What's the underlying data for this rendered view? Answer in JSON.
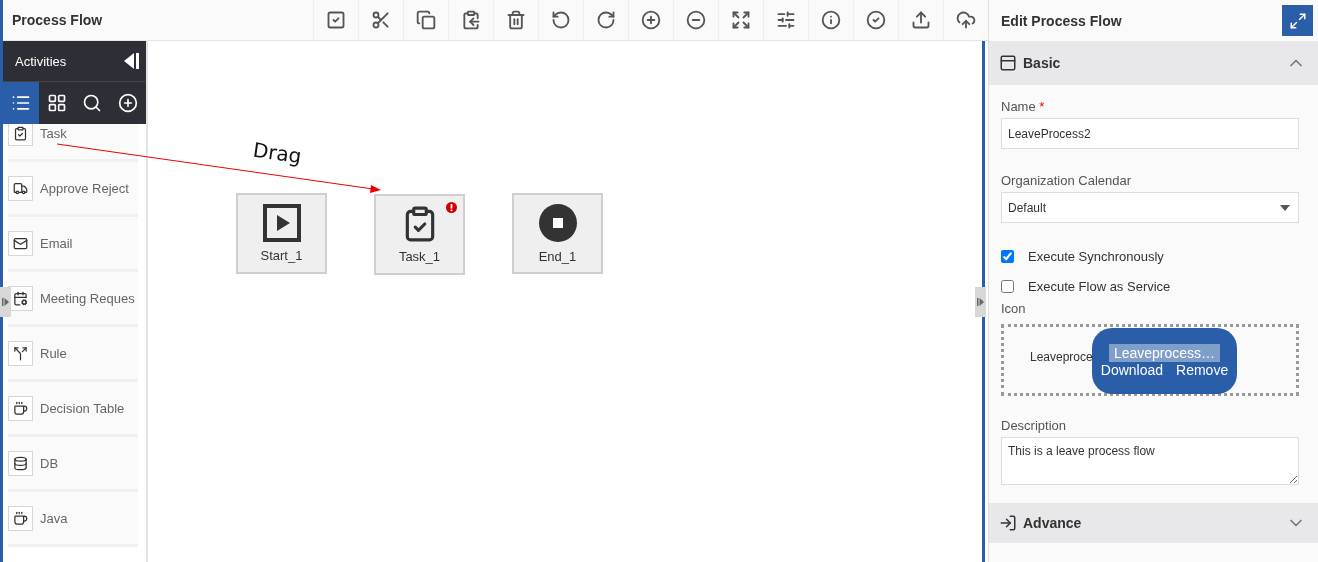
{
  "header": {
    "title": "Process Flow"
  },
  "palette": {
    "title": "Activities",
    "tabs": [
      {
        "kind": "list",
        "selected": true
      },
      {
        "kind": "grid",
        "selected": false
      },
      {
        "kind": "search",
        "selected": false
      },
      {
        "kind": "add",
        "selected": false
      }
    ],
    "items": [
      {
        "kind": "task",
        "label": "Task"
      },
      {
        "kind": "approve",
        "label": "Approve Reject"
      },
      {
        "kind": "email",
        "label": "Email"
      },
      {
        "kind": "meeting",
        "label": "Meeting Reques"
      },
      {
        "kind": "rule",
        "label": "Rule"
      },
      {
        "kind": "decision",
        "label": "Decision Table"
      },
      {
        "kind": "db",
        "label": "DB"
      },
      {
        "kind": "java",
        "label": "Java"
      }
    ]
  },
  "canvas": {
    "annotation": "Drag",
    "nodes": [
      {
        "kind": "start",
        "label": "Start_1",
        "error": false
      },
      {
        "kind": "task",
        "label": "Task_1",
        "error": true
      },
      {
        "kind": "end",
        "label": "End_1",
        "error": false
      }
    ]
  },
  "panel": {
    "title": "Edit Process Flow",
    "basic": {
      "title": "Basic",
      "expanded": true
    },
    "name": {
      "label": "Name",
      "required_mark": "*",
      "value": "LeaveProcess2"
    },
    "calendar": {
      "label": "Organization Calendar",
      "value": "Default"
    },
    "options": [
      {
        "label": "Execute Synchronously",
        "checked": true
      },
      {
        "label": "Execute Flow as Service",
        "checked": false
      }
    ],
    "icon": {
      "label": "Icon",
      "file": "Leaveproce",
      "preview": "Leaveprocess…",
      "actions": [
        "Download",
        "Remove"
      ]
    },
    "description": {
      "label": "Description",
      "value": "This is a leave process flow"
    },
    "advance": {
      "title": "Advance",
      "expanded": false
    }
  }
}
